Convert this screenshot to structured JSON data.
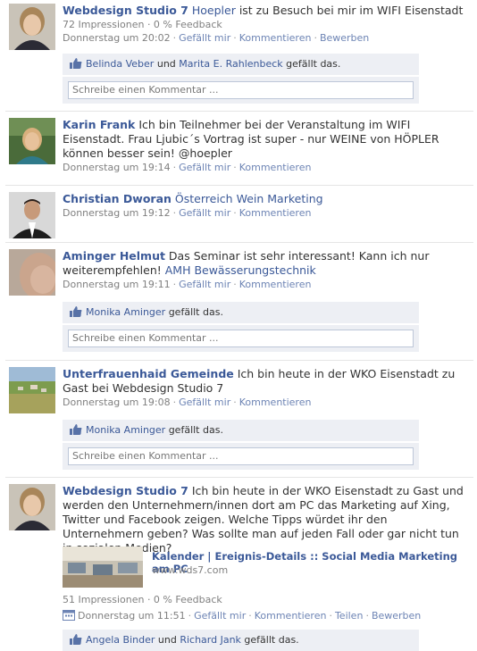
{
  "posts": [
    {
      "author": "Webdesign Studio 7",
      "text_link": "Hoepler",
      "text": " ist zu Besuch bei mir im WIFI Eisenstadt",
      "stats": "72 Impressionen · 0 % Feedback",
      "time": "Donnerstag um 20:02",
      "actions": [
        "Gefällt mir",
        "Kommentieren",
        "Bewerben"
      ],
      "likers": [
        "Belinda Veber",
        "Marita E. Rahlenbeck"
      ],
      "like_conj": "und",
      "like_suffix": " gefällt das.",
      "comment_placeholder": "Schreibe einen Kommentar ..."
    },
    {
      "author": "Karin Frank",
      "text": " Ich bin Teilnehmer bei der Veranstaltung im WIFI Eisenstadt. Frau Ljubic´s Vortrag ist super - nur WEINE von HÖPLER können besser sein! @hoepler",
      "time": "Donnerstag um 19:14",
      "actions": [
        "Gefällt mir",
        "Kommentieren"
      ]
    },
    {
      "author": "Christian Dworan",
      "text_link": "Österreich Wein Marketing",
      "time": "Donnerstag um 19:12",
      "actions": [
        "Gefällt mir",
        "Kommentieren"
      ]
    },
    {
      "author": "Aminger Helmut",
      "text": " Das Seminar ist sehr interessant! Kann ich nur weiterempfehlen! ",
      "text_link": "AMH Bewässerungstechnik",
      "time": "Donnerstag um 19:11",
      "actions": [
        "Gefällt mir",
        "Kommentieren"
      ],
      "likers": [
        "Monika Aminger"
      ],
      "like_suffix": " gefällt das.",
      "comment_placeholder": "Schreibe einen Kommentar ..."
    },
    {
      "author": "Unterfrauenhaid Gemeinde",
      "text": " Ich bin heute in der WKO Eisenstadt zu Gast bei Webdesign Studio 7",
      "time": "Donnerstag um 19:08",
      "actions": [
        "Gefällt mir",
        "Kommentieren"
      ],
      "likers": [
        "Monika Aminger"
      ],
      "like_suffix": " gefällt das.",
      "comment_placeholder": "Schreibe einen Kommentar ..."
    },
    {
      "author": "Webdesign Studio 7",
      "text": " Ich bin heute in der WKO Eisenstadt zu Gast und werden den Unternehmern/innen dort am PC das Marketing auf Xing, Twitter und Facebook zeigen. Welche Tipps würdet ihr den Unternehmern geben? Was sollte man auf jeden Fall oder gar nicht tun in sozialen Medien?",
      "attachment_title": "Kalender | Ereignis-Details :: Social Media Marketing am PC",
      "attachment_url": "www.wds7.com",
      "stats": "51 Impressionen · 0 % Feedback",
      "time": "Donnerstag um 11:51",
      "actions": [
        "Gefällt mir",
        "Kommentieren",
        "Teilen",
        "Bewerben"
      ],
      "likers": [
        "Angela Binder",
        "Richard Jank"
      ],
      "like_conj": "und",
      "like_suffix": " gefällt das."
    }
  ],
  "icons": {
    "like": "thumbs-up-icon",
    "calendar": "calendar-icon"
  },
  "colors": {
    "link": "#3b5998",
    "meta": "#808080",
    "box_bg": "#edeff4"
  }
}
